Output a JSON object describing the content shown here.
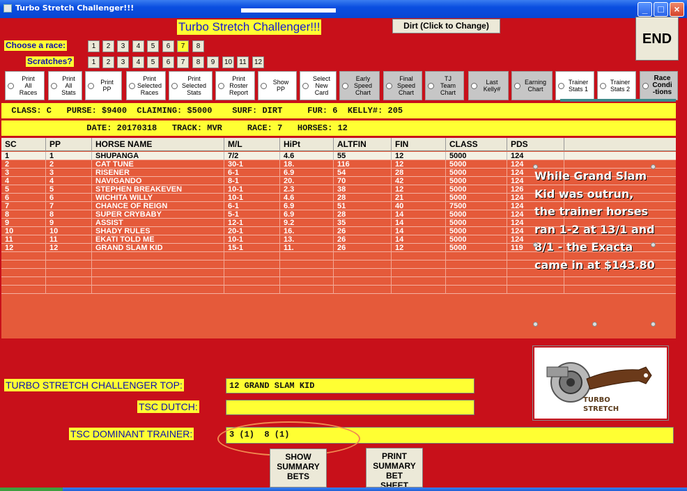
{
  "window": {
    "title": "Turbo Stretch Challenger!!!"
  },
  "header": {
    "main_title": "Turbo Stretch Challenger!!!",
    "dirt_button": "Dirt (Click to Change)",
    "end_button": "END"
  },
  "races": {
    "label": "Choose  a race:",
    "items": [
      "1",
      "2",
      "3",
      "4",
      "5",
      "6",
      "7",
      "8"
    ],
    "selected": "7"
  },
  "scratches": {
    "label": "Scratches?",
    "items": [
      "1",
      "2",
      "3",
      "4",
      "5",
      "6",
      "7",
      "8",
      "9",
      "10",
      "11",
      "12"
    ]
  },
  "options": [
    {
      "label": "Print\nAll\nRaces"
    },
    {
      "label": "Print\nAll\nStats"
    },
    {
      "label": "Print\nPP"
    },
    {
      "label": "Print\nSelected\nRaces"
    },
    {
      "label": "Print\nSelected\nStats"
    },
    {
      "label": "Print\nRoster\nReport"
    },
    {
      "label": "Show\nPP"
    },
    {
      "label": "Select\nNew\nCard"
    },
    {
      "label": "Early\nSpeed\nChart"
    },
    {
      "label": "Final\nSpeed\nChart"
    },
    {
      "label": "TJ\nTeam\nChart"
    },
    {
      "label": "Last\nKelly#"
    },
    {
      "label": "Earning\nChart"
    },
    {
      "label": "Trainer\nStats 1"
    },
    {
      "label": "Trainer\nStats 2"
    },
    {
      "label": "Race\nCondi\n-tions"
    }
  ],
  "race_info": {
    "line1": "  CLASS: C   PURSE: $9400  CLAIMING: $5000    SURF: DIRT     FUR: 6  KELLY#: 205",
    "line2": "                 DATE: 20170318   TRACK: MVR     RACE: 7   HORSES: 12"
  },
  "table": {
    "headers": [
      "SC",
      "PP",
      "HORSE NAME",
      "M/L",
      "HiPt",
      "ALTFIN",
      "FIN",
      "CLASS",
      "PDS"
    ],
    "rows": [
      [
        "1",
        "1",
        "SHUPANGA",
        "7/2",
        "4.6",
        "55",
        "12",
        "5000",
        "124"
      ],
      [
        "2",
        "2",
        "CAT TUNE",
        "30-1",
        "18.",
        "116",
        "12",
        "5000",
        "124"
      ],
      [
        "3",
        "3",
        "RISENER",
        "6-1",
        "6.9",
        "54",
        "28",
        "5000",
        "124"
      ],
      [
        "4",
        "4",
        "NAVIGANDO",
        "8-1",
        "20.",
        "70",
        "42",
        "5000",
        "124"
      ],
      [
        "5",
        "5",
        "STEPHEN BREAKEVEN",
        "10-1",
        "2.3",
        "38",
        "12",
        "5000",
        "126"
      ],
      [
        "6",
        "6",
        "WICHITA WILLY",
        "10-1",
        "4.6",
        "28",
        "21",
        "5000",
        "124"
      ],
      [
        "7",
        "7",
        "CHANCE OF REIGN",
        "6-1",
        "6.9",
        "51",
        "40",
        "7500",
        "124"
      ],
      [
        "8",
        "8",
        "SUPER CRYBABY",
        "5-1",
        "6.9",
        "28",
        "14",
        "5000",
        "124"
      ],
      [
        "9",
        "9",
        "ASSIST",
        "12-1",
        "9.2",
        "35",
        "14",
        "5000",
        "124"
      ],
      [
        "10",
        "10",
        "SHADY RULES",
        "20-1",
        "16.",
        "26",
        "14",
        "5000",
        "124"
      ],
      [
        "11",
        "11",
        "EKATI TOLD ME",
        "10-1",
        "13.",
        "26",
        "14",
        "5000",
        "124"
      ],
      [
        "12",
        "12",
        "GRAND SLAM KID",
        "15-1",
        "11.",
        "26",
        "12",
        "5000",
        "119"
      ],
      [
        "",
        "",
        "",
        "",
        "",
        "",
        "",
        "",
        ""
      ],
      [
        "",
        "",
        "",
        "",
        "",
        "",
        "",
        "",
        ""
      ],
      [
        "",
        "",
        "",
        "",
        "",
        "",
        "",
        "",
        ""
      ],
      [
        "",
        "",
        "",
        "",
        "",
        "",
        "",
        "",
        ""
      ],
      [
        "",
        "",
        "",
        "",
        "",
        "",
        "",
        "",
        ""
      ]
    ]
  },
  "annotation": {
    "text": "While Grand Slam Kid was outrun, the trainer horses ran 1-2 at 13/1 and 8/1 - the Exacta came in at $143.80"
  },
  "logo": {
    "line1": "TURBO",
    "line2": "STRETCH"
  },
  "fields": {
    "top_label": "TURBO STRETCH CHALLENGER TOP:",
    "top_value": "12 GRAND SLAM KID",
    "dutch_label": "TSC DUTCH:",
    "dutch_value": "",
    "trainer_label": "TSC DOMINANT TRAINER:",
    "trainer_value": "3 (1)  8 (1)"
  },
  "buttons": {
    "show_summary": "SHOW\nSUMMARY\nBETS",
    "print_summary": "PRINT\nSUMMARY\nBET\nSHEET"
  }
}
